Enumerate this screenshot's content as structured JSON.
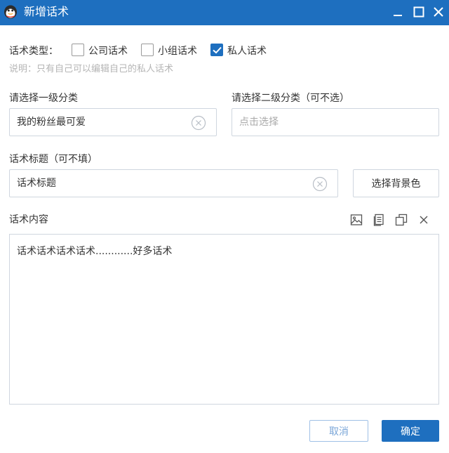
{
  "window": {
    "title": "新增话术"
  },
  "type_row": {
    "label": "话术类型：",
    "options": [
      {
        "label": "公司话术",
        "checked": false
      },
      {
        "label": "小组话术",
        "checked": false
      },
      {
        "label": "私人话术",
        "checked": true
      }
    ],
    "hint": "说明：只有自己可以编辑自己的私人话术"
  },
  "category1": {
    "label": "请选择一级分类",
    "value": "我的粉丝最可爱"
  },
  "category2": {
    "label": "请选择二级分类（可不选）",
    "placeholder": "点击选择"
  },
  "title_field": {
    "label": "话术标题（可不填）",
    "value": "话术标题"
  },
  "bg_color_button": "选择背景色",
  "content": {
    "label": "话术内容",
    "text": "话术话术话术话术............好多话术",
    "toolbar": [
      "image-icon",
      "document-icon",
      "copy-icon",
      "close-icon"
    ]
  },
  "footer": {
    "cancel_label": "取消",
    "ok_label": "确定"
  },
  "colors": {
    "titlebar": "#1e6fbf",
    "accent": "#1e6fbf",
    "border": "#cfd6df",
    "hint": "#b5b5b5"
  }
}
